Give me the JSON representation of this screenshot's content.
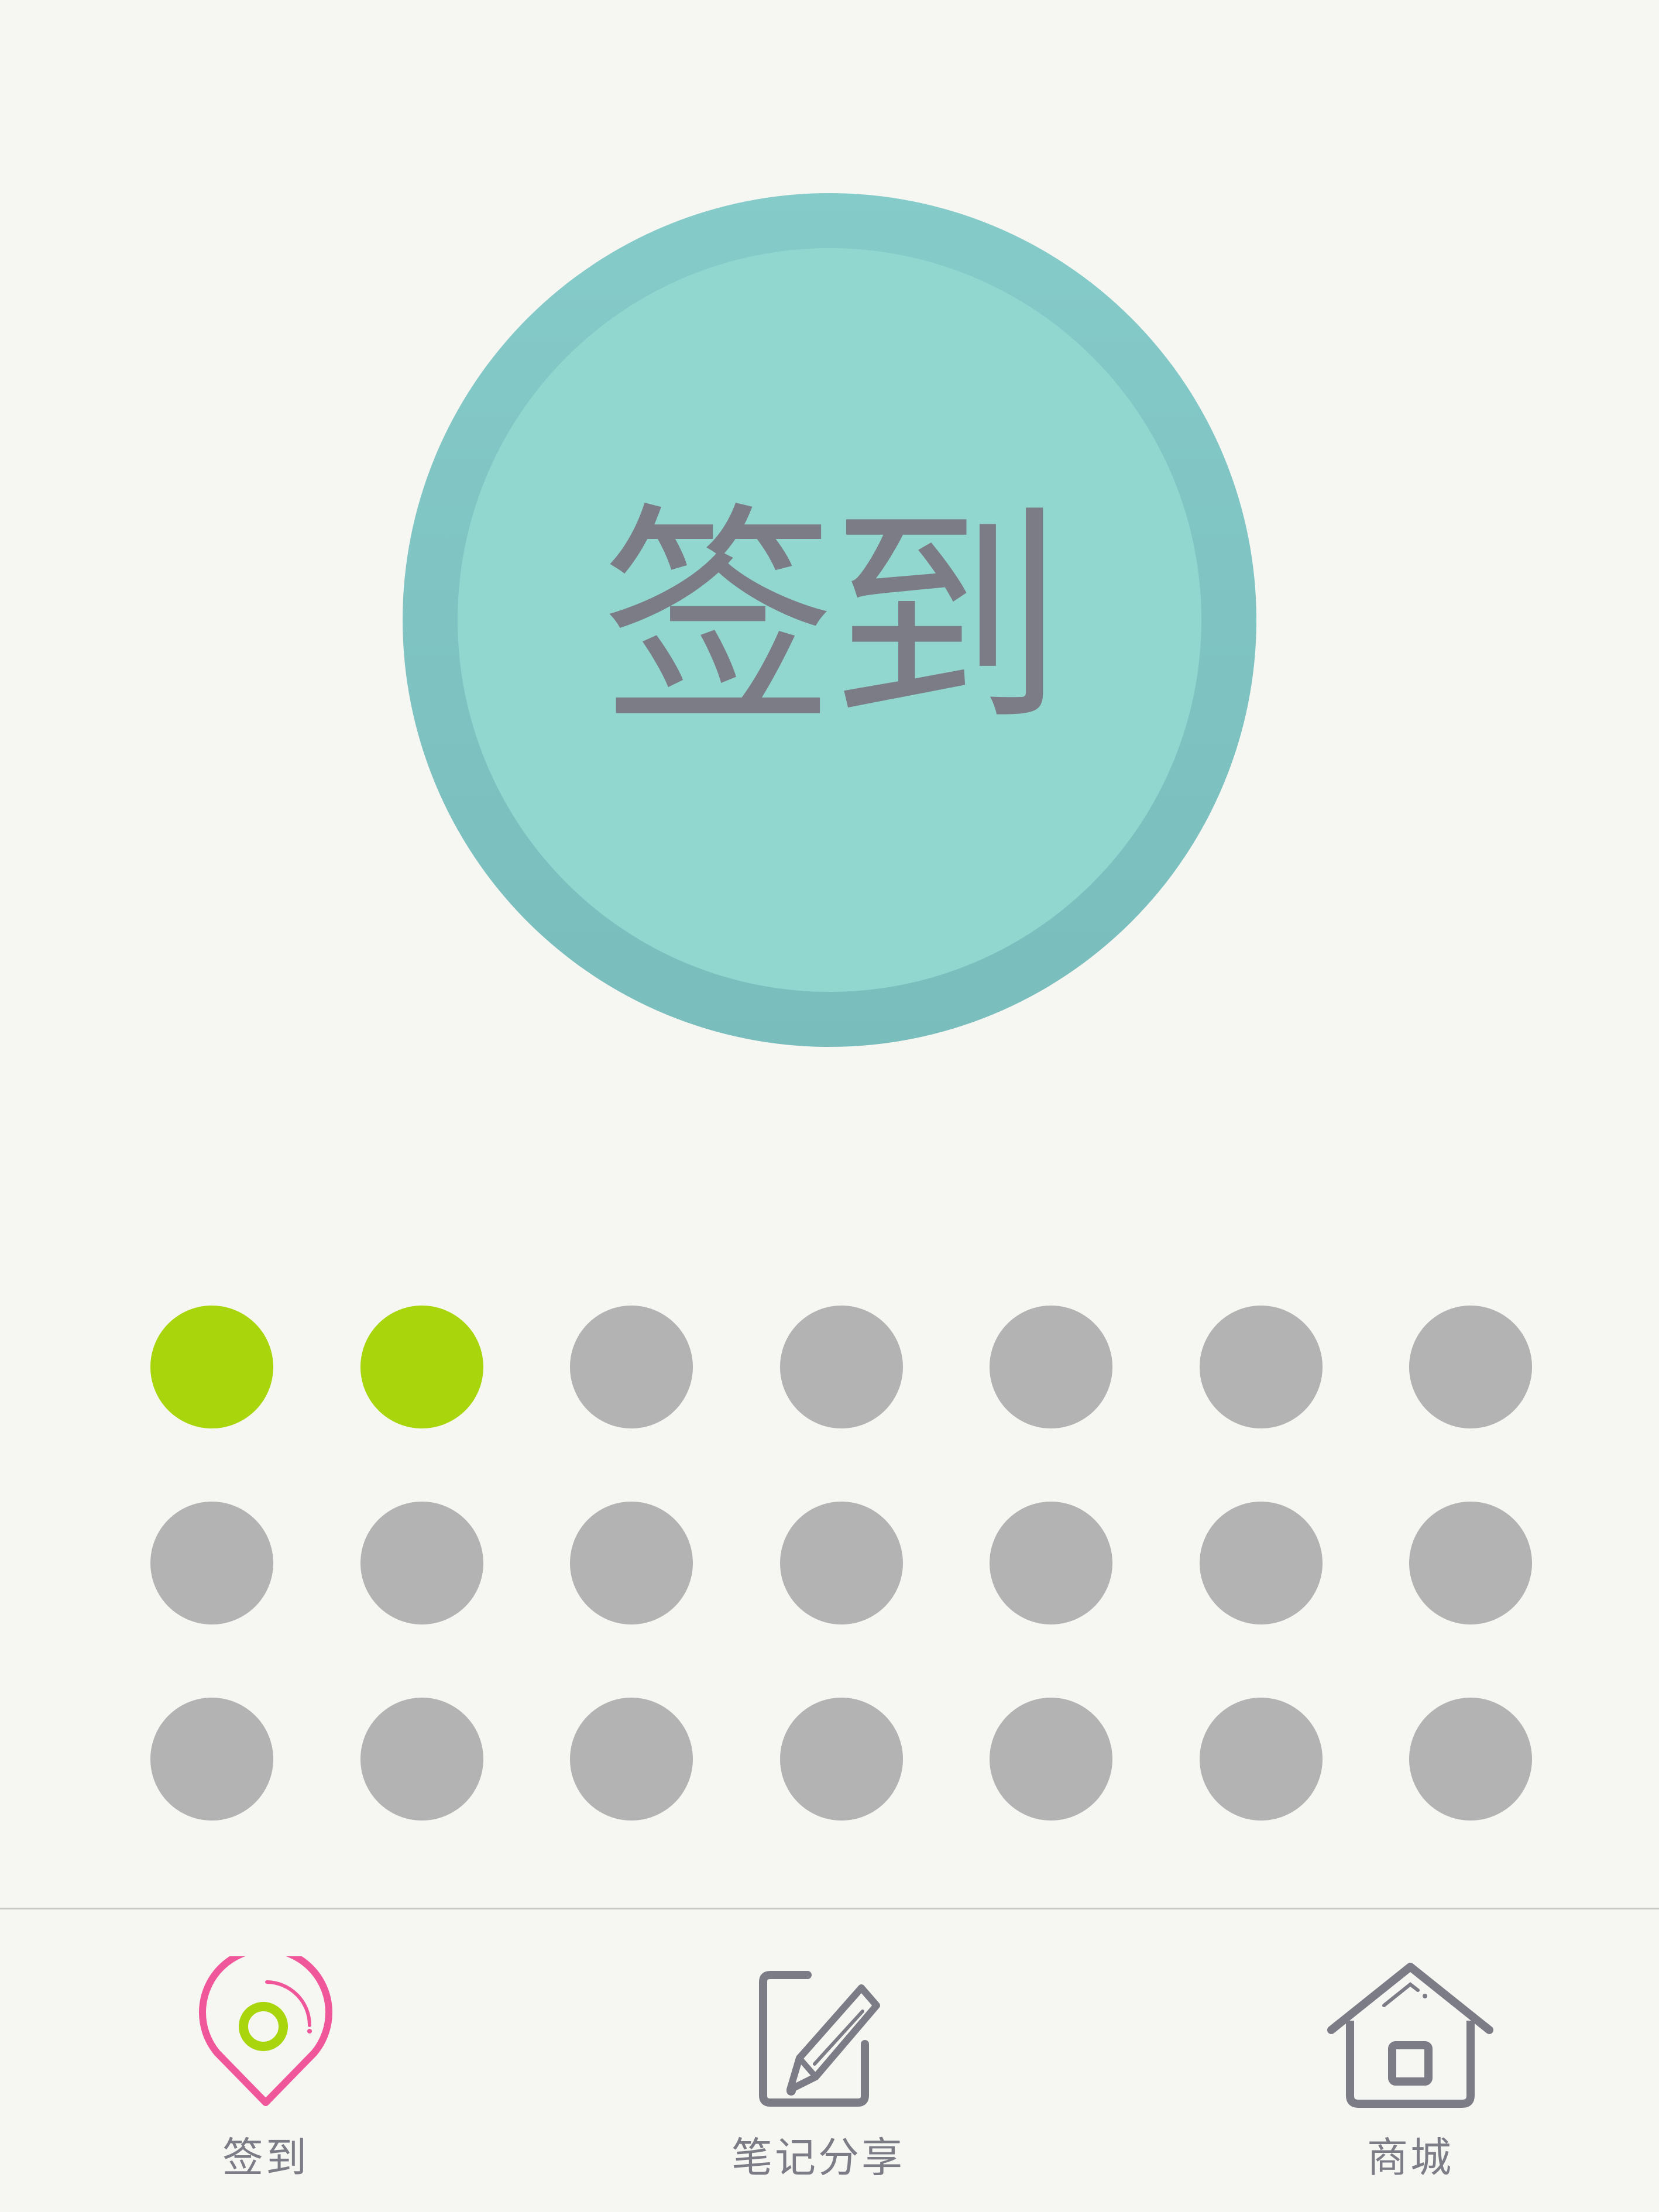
{
  "checkin_button": {
    "label": "签到"
  },
  "calendar": {
    "rows": 3,
    "columns": 7,
    "checked_days": 2,
    "colors": {
      "checked": "#a8d50b",
      "unchecked": "#b3b3b3"
    }
  },
  "tabbar": {
    "tabs": [
      {
        "label": "签到",
        "icon": "location-pin-icon",
        "active": true,
        "color": "#f0579a"
      },
      {
        "label": "笔记分享",
        "icon": "note-edit-icon",
        "active": false
      },
      {
        "label": "商城",
        "icon": "home-icon",
        "active": false
      }
    ]
  },
  "colors": {
    "background": "#f6f6f2",
    "button_outer": "#85cbc9",
    "button_inner": "#92d7cf",
    "text": "#7b7c86",
    "accent_pink": "#f0579a",
    "accent_green": "#a8d50b"
  }
}
